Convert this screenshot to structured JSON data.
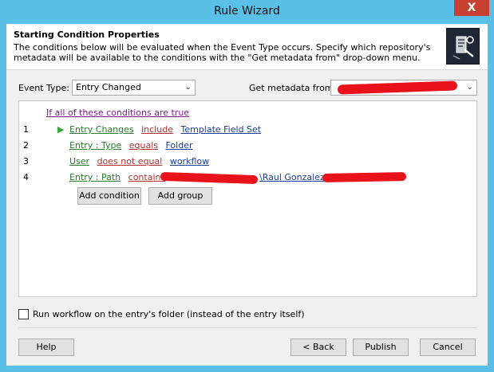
{
  "window": {
    "title": "Rule Wizard",
    "close_label": "X"
  },
  "header": {
    "title": "Starting Condition Properties",
    "description": "The conditions below will be evaluated when the Event Type occurs. Specify which repository's metadata will be available to the conditions with the \"Get metadata from\" drop-down menu."
  },
  "event_type": {
    "label": "Event Type:",
    "value": "Entry Changed"
  },
  "metadata": {
    "label": "Get metadata from:",
    "value": ""
  },
  "conditions": {
    "header_link": "If all of these conditions are true",
    "rows": [
      {
        "num": "1",
        "field": "Entry Changes",
        "op": "include",
        "value": "Template Field Set"
      },
      {
        "num": "2",
        "field": "Entry : Type",
        "op": "equals",
        "value": "Folder"
      },
      {
        "num": "3",
        "field": "User",
        "op": "does not equal",
        "value": "workflow"
      },
      {
        "num": "4",
        "field": "Entry : Path",
        "op": "contains",
        "value_visible": "\\Raul Gonzalez\\"
      }
    ],
    "add_condition_label": "Add condition",
    "add_group_label": "Add group"
  },
  "options": {
    "run_on_folder_label": "Run workflow on the entry's folder (instead of the entry itself)",
    "run_on_folder_checked": false
  },
  "footer": {
    "help_label": "Help",
    "back_label": "< Back",
    "publish_label": "Publish",
    "cancel_label": "Cancel"
  },
  "colors": {
    "titlebar": "#5bc0e8",
    "close_button": "#c7402f",
    "field_link": "#2e7d2e",
    "operator_link": "#b03030",
    "value_link": "#1a3c9b",
    "group_link": "#7a1e8a",
    "redaction": "#e8121b"
  },
  "icons": [
    "play-arrow-icon",
    "dropdown-chevron-icon",
    "wizard-header-icon"
  ]
}
